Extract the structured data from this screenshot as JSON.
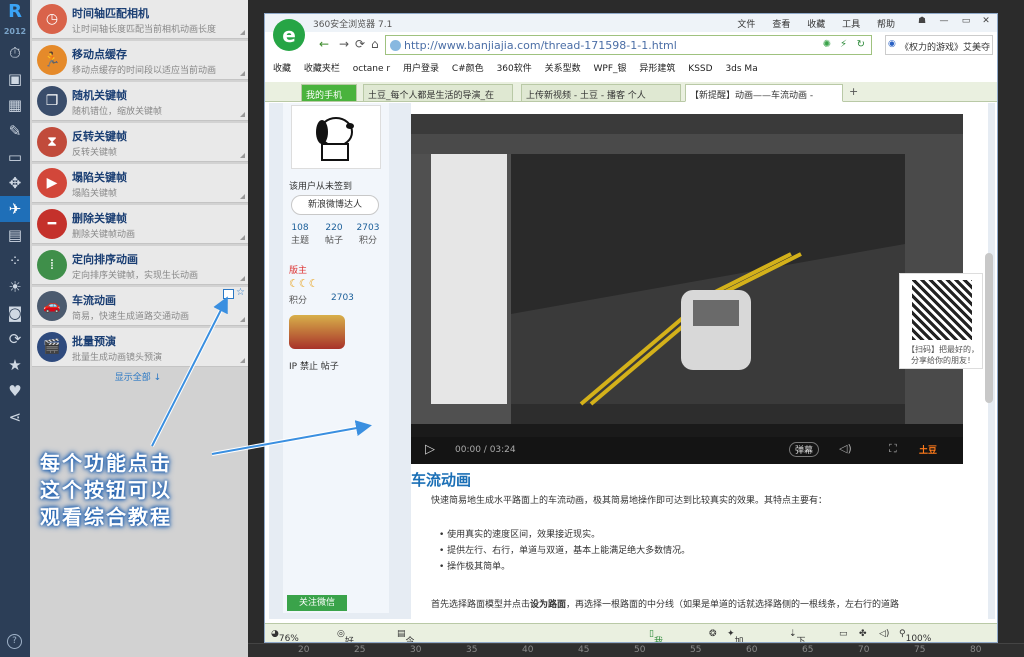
{
  "rail": {
    "logo": "R",
    "version": "2012",
    "icons": [
      "clock-icon",
      "grid-icon",
      "pencil-icon",
      "monitor-icon",
      "move-icon",
      "plane-icon",
      "inbox-icon",
      "apps-icon",
      "sun-icon",
      "camera-icon",
      "refresh-icon",
      "star-icon",
      "heart-icon",
      "share-icon"
    ],
    "help": "?"
  },
  "panel": {
    "items": [
      {
        "title": "时间轴匹配相机",
        "desc": "让时间轴长度匹配当前相机动画长度",
        "color": "#d9634a",
        "icon": "clock-icon"
      },
      {
        "title": "移动点缓存",
        "desc": "移动点缓存的时间段以适应当前动画",
        "color": "#e58a2a",
        "icon": "runner-icon"
      },
      {
        "title": "随机关键帧",
        "desc": "随机错位，缩放关键帧",
        "color": "#3a4d6b",
        "icon": "copy-icon"
      },
      {
        "title": "反转关键帧",
        "desc": "反转关键帧",
        "color": "#c14b3b",
        "icon": "hourglass-icon"
      },
      {
        "title": "塌陷关键帧",
        "desc": "塌陷关键帧",
        "color": "#d2473a",
        "icon": "play-icon"
      },
      {
        "title": "删除关键帧",
        "desc": "删除关键帧动画",
        "color": "#c4312b",
        "icon": "minus-icon"
      },
      {
        "title": "定向排序动画",
        "desc": "定向排序关键帧，实现生长动画",
        "color": "#3f8f4a",
        "icon": "footprint-icon"
      },
      {
        "title": "车流动画",
        "desc": "简易，快速生成道路交通动画",
        "color": "#4b5a6e",
        "icon": "car-icon"
      },
      {
        "title": "批量预演",
        "desc": "批量生成动画镜头预演",
        "color": "#2e4a7d",
        "icon": "clapper-icon"
      }
    ],
    "show_all": "显示全部 ↓"
  },
  "annotation": {
    "line1": "每个功能点击",
    "line2": "这个按钮可以",
    "line3": "观看综合教程"
  },
  "browser": {
    "title": "360安全浏览器 7.1",
    "menus": [
      "文件",
      "查看",
      "收藏",
      "工具",
      "帮助"
    ],
    "url": "http://www.banjiajia.com/thread-171598-1-1.html",
    "search": "《权力的游戏》艾美夺",
    "bookmarks": [
      "收藏",
      "收藏夹栏",
      "octane r",
      "用户登录",
      "C#颜色",
      "360软件",
      "关系型数",
      "WPF_银",
      "异形建筑",
      "KSSD",
      "3ds Ma"
    ],
    "tabs": [
      "我的手机",
      "土豆_每个人都是生活的导演_在",
      "上传新视频 - 土豆 - 播客 个人",
      "【新提醒】动画——车流动画 -"
    ],
    "status": {
      "rating": "76%好评",
      "recommend": "好搜推荐",
      "today": "今日特卖",
      "phone": "我的手机",
      "accel": "加速器",
      "download": "下载",
      "zoom": "100%"
    }
  },
  "forum": {
    "guest": "该用户从未签到",
    "weibo": "新浪微博达人",
    "stats": [
      {
        "value": "108",
        "label": "主题"
      },
      {
        "value": "220",
        "label": "帖子"
      },
      {
        "value": "2703",
        "label": "积分"
      }
    ],
    "role": "版主",
    "points_label": "积分",
    "points": "2703",
    "ip_ban": "IP 禁止 帖子",
    "follow": "关注微信",
    "video_time": "00:00 / 03:24",
    "danmu": "弹幕",
    "brand": "土豆",
    "qr_text": "【扫码】把最好的，分享给你的朋友！",
    "heading": "车流动画",
    "intro": "快速简易地生成水平路面上的车流动画，极其简易地操作即可达到比较真实的效果。其特点主要有：",
    "bullets": [
      "使用真实的速度区间，效果接近现实。",
      "提供左行、右行，单道与双道，基本上能满足绝大多数情况。",
      "操作极其简单。"
    ],
    "para2_a": "首先选择路面模型并点击",
    "para2_b": "设为路面",
    "para2_c": "，再选择一根路面的中分线（如果是单道的话就选择路侧的一根线条，左右行的道路"
  },
  "ruler": [
    "20",
    "25",
    "30",
    "35",
    "40",
    "45",
    "50",
    "55",
    "60",
    "65",
    "70",
    "75",
    "80"
  ]
}
